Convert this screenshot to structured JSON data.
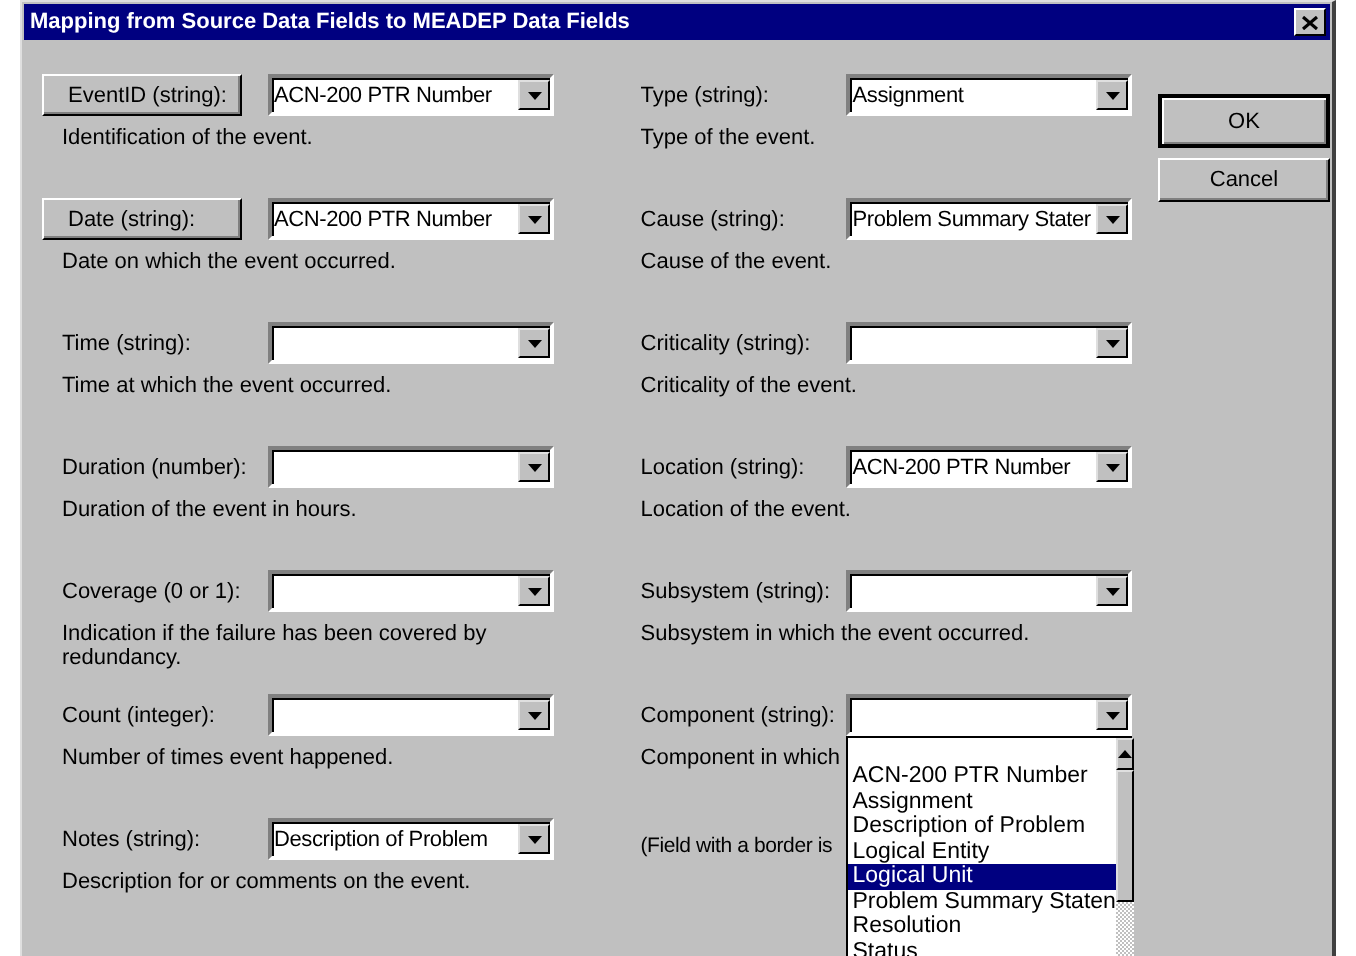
{
  "window": {
    "title": "Mapping from Source Data Fields to MEADEP Data Fields"
  },
  "left_fields": [
    {
      "label": "EventID (string):",
      "bordered": true,
      "value": "ACN-200 PTR Number",
      "description": "Identification of the event."
    },
    {
      "label": "Date (string):",
      "bordered": true,
      "value": "ACN-200 PTR Number",
      "description": "Date on which the event occurred."
    },
    {
      "label": "Time (string):",
      "bordered": false,
      "description": "Time at which the event occurred."
    },
    {
      "label": "Duration (number):",
      "bordered": false,
      "description": "Duration of the event in hours."
    },
    {
      "label": "Coverage (0 or 1):",
      "bordered": false,
      "description": "Indication if the failure has been covered by redundancy."
    },
    {
      "label": "Count (integer):",
      "bordered": false,
      "description": "Number of times event happened."
    },
    {
      "label": "Notes (string):",
      "bordered": false,
      "value": "Description of Problem",
      "description": "Description for or comments on the event."
    }
  ],
  "right_fields": [
    {
      "label": "Type (string):",
      "bordered": false,
      "value": "Assignment",
      "description": "Type of the event."
    },
    {
      "label": "Cause (string):",
      "bordered": false,
      "value": "Problem Summary Stater",
      "description": "Cause of the event."
    },
    {
      "label": "Criticality (string):",
      "bordered": false,
      "description": "Criticality of the event."
    },
    {
      "label": "Location (string):",
      "bordered": false,
      "value": "ACN-200 PTR Number",
      "description": "Location of the event."
    },
    {
      "label": "Subsystem (string):",
      "bordered": false,
      "description": "Subsystem in which the event occurred."
    },
    {
      "label": "Component (string):",
      "bordered": false,
      "description": "Component in which",
      "expanded": true,
      "options": [
        {
          "label": "ACN-200 PTR Number",
          "selected": false
        },
        {
          "label": "Assignment",
          "selected": false
        },
        {
          "label": "Description of Problem",
          "selected": false
        },
        {
          "label": "Logical Entity",
          "selected": false
        },
        {
          "label": "Logical Unit",
          "selected": true
        },
        {
          "label": "Problem Summary Staten",
          "selected": false
        },
        {
          "label": "Resolution",
          "selected": false
        },
        {
          "label": "Status",
          "selected": false
        }
      ]
    }
  ],
  "note": "(Field with a border is",
  "buttons": [
    {
      "label": "OK",
      "default": true
    },
    {
      "label": "Cancel",
      "default": false
    }
  ]
}
